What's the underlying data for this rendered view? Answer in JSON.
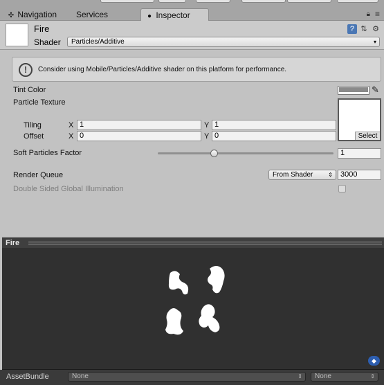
{
  "tabs": [
    {
      "label": "Navigation",
      "icon": "navigation-icon"
    },
    {
      "label": "Services"
    },
    {
      "label": "Inspector",
      "icon": "info-icon"
    }
  ],
  "material": {
    "name": "Fire",
    "shader_label": "Shader",
    "shader_value": "Particles/Additive"
  },
  "warning": {
    "text": "Consider using Mobile/Particles/Additive shader on this platform for performance."
  },
  "properties": {
    "tint_color_label": "Tint Color",
    "tint_color": "#8a8a8a",
    "particle_texture_label": "Particle Texture",
    "texture_select": "Select",
    "tiling_label": "Tiling",
    "tiling_x_label": "X",
    "tiling_x": "1",
    "tiling_y_label": "Y",
    "tiling_y": "1",
    "offset_label": "Offset",
    "offset_x_label": "X",
    "offset_x": "0",
    "offset_y_label": "Y",
    "offset_y": "0",
    "soft_particles_label": "Soft Particles Factor",
    "soft_particles_value": "1",
    "soft_particles_fraction": 0.32,
    "render_queue_label": "Render Queue",
    "render_queue_mode": "From Shader",
    "render_queue_value": "3000",
    "dsgi_label": "Double Sided Global Illumination",
    "dsgi_checked": false
  },
  "preview": {
    "title": "Fire",
    "background": "#303030"
  },
  "asset_bundle": {
    "label": "AssetBundle",
    "name": "None",
    "variant": "None"
  }
}
